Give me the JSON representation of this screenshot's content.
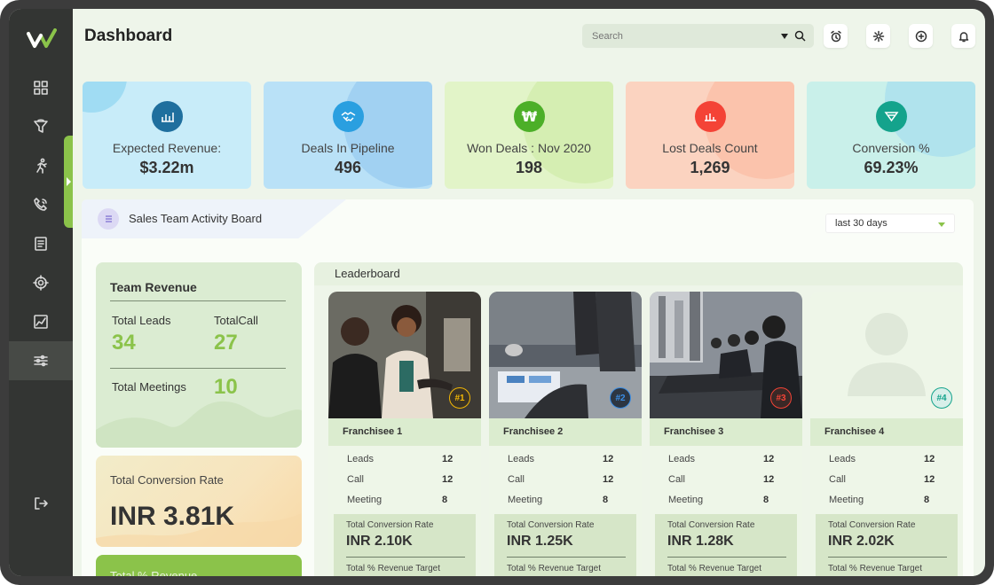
{
  "header": {
    "title": "Dashboard",
    "search_placeholder": "Search"
  },
  "sidebar": {
    "items": [
      {
        "icon": "grid-icon"
      },
      {
        "icon": "funnel-icon"
      },
      {
        "icon": "runner-icon"
      },
      {
        "icon": "phone-icon"
      },
      {
        "icon": "document-icon"
      },
      {
        "icon": "target-icon"
      },
      {
        "icon": "chart-icon"
      },
      {
        "icon": "sliders-icon",
        "active": true
      }
    ],
    "logout_icon": "logout-icon"
  },
  "stats": [
    {
      "label": "Expected Revenue:",
      "value": "$3.22m",
      "icon": "bar-chart-icon",
      "bg": "#c8ecf9",
      "accent": "#1f6f9e"
    },
    {
      "label": "Deals In Pipeline",
      "value": "496",
      "icon": "handshake-icon",
      "bg": "#b9e1f7",
      "accent": "#2a9fe0"
    },
    {
      "label": "Won Deals : Nov 2020",
      "value": "198",
      "icon": "won-icon",
      "bg": "#e2f4c8",
      "accent": "#4caf28"
    },
    {
      "label": "Lost Deals Count",
      "value": "1,269",
      "icon": "lost-chart-icon",
      "bg": "#fbd3c0",
      "accent": "#f44336"
    },
    {
      "label": "Conversion %",
      "value": "69.23%",
      "icon": "conversion-funnel-icon",
      "bg": "#c9f0ea",
      "accent": "#14a38c"
    }
  ],
  "board": {
    "title": "Sales Team Activity Board",
    "range": "last 30 days"
  },
  "team": {
    "title": "Team Revenue",
    "leads_label": "Total Leads",
    "leads_value": "34",
    "calls_label": "TotalCall",
    "calls_value": "27",
    "meetings_label": "Total  Meetings",
    "meetings_value": "10"
  },
  "conversion": {
    "label": "Total  Conversion Rate",
    "value": "INR 3.81K"
  },
  "revenue": {
    "label": "Total  % Revenue"
  },
  "leaderboard": {
    "title": "Leaderboard",
    "franchisees": [
      {
        "name": "Franchisee 1",
        "rank": "#1",
        "rank_color": "#f2b705",
        "leads": "12",
        "call": "12",
        "meeting": "8",
        "conv_label": "Total  Conversion Rate",
        "conv_value": "INR 2.10K",
        "rev_label": "Total  % Revenue Target"
      },
      {
        "name": "Franchisee 2",
        "rank": "#2",
        "rank_color": "#3a8ee6",
        "leads": "12",
        "call": "12",
        "meeting": "8",
        "conv_label": "Total  Conversion Rate",
        "conv_value": "INR 1.25K",
        "rev_label": "Total  % Revenue Target"
      },
      {
        "name": "Franchisee 3",
        "rank": "#3",
        "rank_color": "#f44336",
        "leads": "12",
        "call": "12",
        "meeting": "8",
        "conv_label": "Total  Conversion Rate",
        "conv_value": "INR 1.28K",
        "rev_label": "Total  % Revenue Target"
      },
      {
        "name": "Franchisee 4",
        "rank": "#4",
        "rank_color": "#14a38c",
        "leads": "12",
        "call": "12",
        "meeting": "8",
        "conv_label": "Total  Conversion Rate",
        "conv_value": "INR 2.02K",
        "rev_label": "Total  % Revenue Target"
      }
    ],
    "row_labels": {
      "leads": "Leads",
      "call": "Call",
      "meeting": "Meeting"
    }
  }
}
